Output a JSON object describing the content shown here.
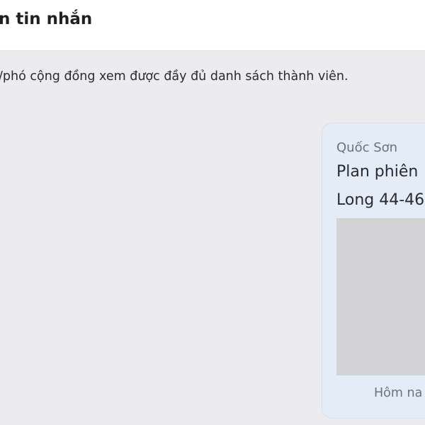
{
  "header": {
    "title": "n tin nhắn"
  },
  "notice": {
    "text": "/phó cộng đồng xem được đầy đủ danh sách thành viên."
  },
  "message": {
    "sender": "Quốc Sơn",
    "line1": "Plan phiên",
    "line2": "Long 44-46",
    "timestamp": "Hôm na"
  },
  "colors": {
    "header_bg": "#ffffff",
    "content_bg": "#ececef",
    "bubble_bg": "#e4ecf8",
    "image_placeholder": "#d3d3d6"
  }
}
